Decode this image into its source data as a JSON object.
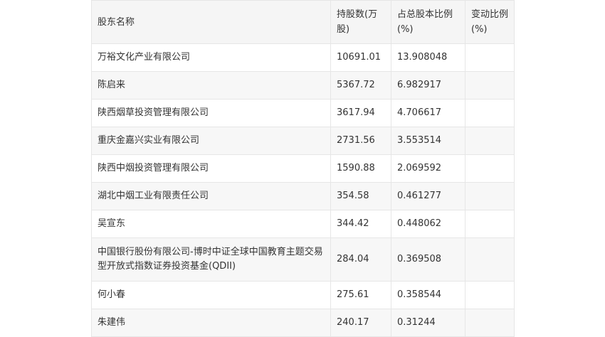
{
  "table": {
    "headers": [
      "股东名称",
      "持股数(万股)",
      "占总股本比例(%)",
      "变动比例(%)"
    ],
    "rows": [
      {
        "name": "万裕文化产业有限公司",
        "shares": "10691.01",
        "ratio": "13.908048",
        "change": ""
      },
      {
        "name": "陈启来",
        "shares": "5367.72",
        "ratio": "6.982917",
        "change": ""
      },
      {
        "name": "陕西烟草投资管理有限公司",
        "shares": "3617.94",
        "ratio": "4.706617",
        "change": ""
      },
      {
        "name": "重庆金嘉兴实业有限公司",
        "shares": "2731.56",
        "ratio": "3.553514",
        "change": ""
      },
      {
        "name": "陕西中烟投资管理有限公司",
        "shares": "1590.88",
        "ratio": "2.069592",
        "change": ""
      },
      {
        "name": "湖北中烟工业有限责任公司",
        "shares": "354.58",
        "ratio": "0.461277",
        "change": ""
      },
      {
        "name": "吴宣东",
        "shares": "344.42",
        "ratio": "0.448062",
        "change": ""
      },
      {
        "name": "中国银行股份有限公司-博时中证全球中国教育主题交易型开放式指数证券投资基金(QDII)",
        "shares": "284.04",
        "ratio": "0.369508",
        "change": ""
      },
      {
        "name": "何小春",
        "shares": "275.61",
        "ratio": "0.358544",
        "change": ""
      },
      {
        "name": "朱建伟",
        "shares": "240.17",
        "ratio": "0.31244",
        "change": ""
      }
    ]
  }
}
